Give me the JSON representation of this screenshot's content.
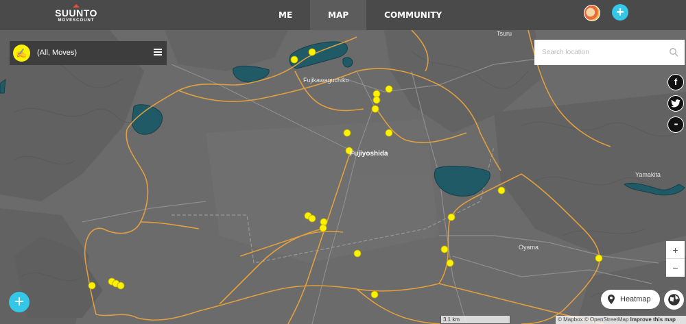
{
  "brand": {
    "name": "SUUNTO",
    "sub": "MOVESCOUNT"
  },
  "nav": {
    "items": [
      {
        "label": "ME"
      },
      {
        "label": "MAP"
      },
      {
        "label": "COMMUNITY"
      }
    ],
    "active": "MAP"
  },
  "header": {
    "avatar_icon": "user-avatar",
    "add_icon": "plus-icon"
  },
  "filter": {
    "label": "(All, Moves)",
    "icon": "activity-icon",
    "menu_icon": "hamburger-icon"
  },
  "search": {
    "placeholder": "Search location",
    "icon": "search-icon"
  },
  "social": [
    {
      "name": "facebook",
      "glyph": "f"
    },
    {
      "name": "twitter",
      "glyph": "t"
    },
    {
      "name": "more",
      "glyph": "•••"
    }
  ],
  "zoom": {
    "in": "+",
    "out": "−"
  },
  "heatmap": {
    "label": "Heatmap"
  },
  "scale": {
    "label": "3.1 km"
  },
  "attribution": {
    "mapbox": "© Mapbox",
    "osm": "© OpenStreetMap",
    "improve": "Improve this map"
  },
  "map_labels": {
    "tsuru": "Tsuru",
    "fujikawaguchiko": "Fujikawaguchiko",
    "fujiyoshida": "Fujiyoshida",
    "yamakita": "Yamakita",
    "oyama": "Oyama"
  },
  "colors": {
    "accent": "#34c7e8",
    "marker": "#fff200",
    "track": "#e8a33d",
    "water": "#1f5a66",
    "topbar": "#4a4a4a"
  }
}
